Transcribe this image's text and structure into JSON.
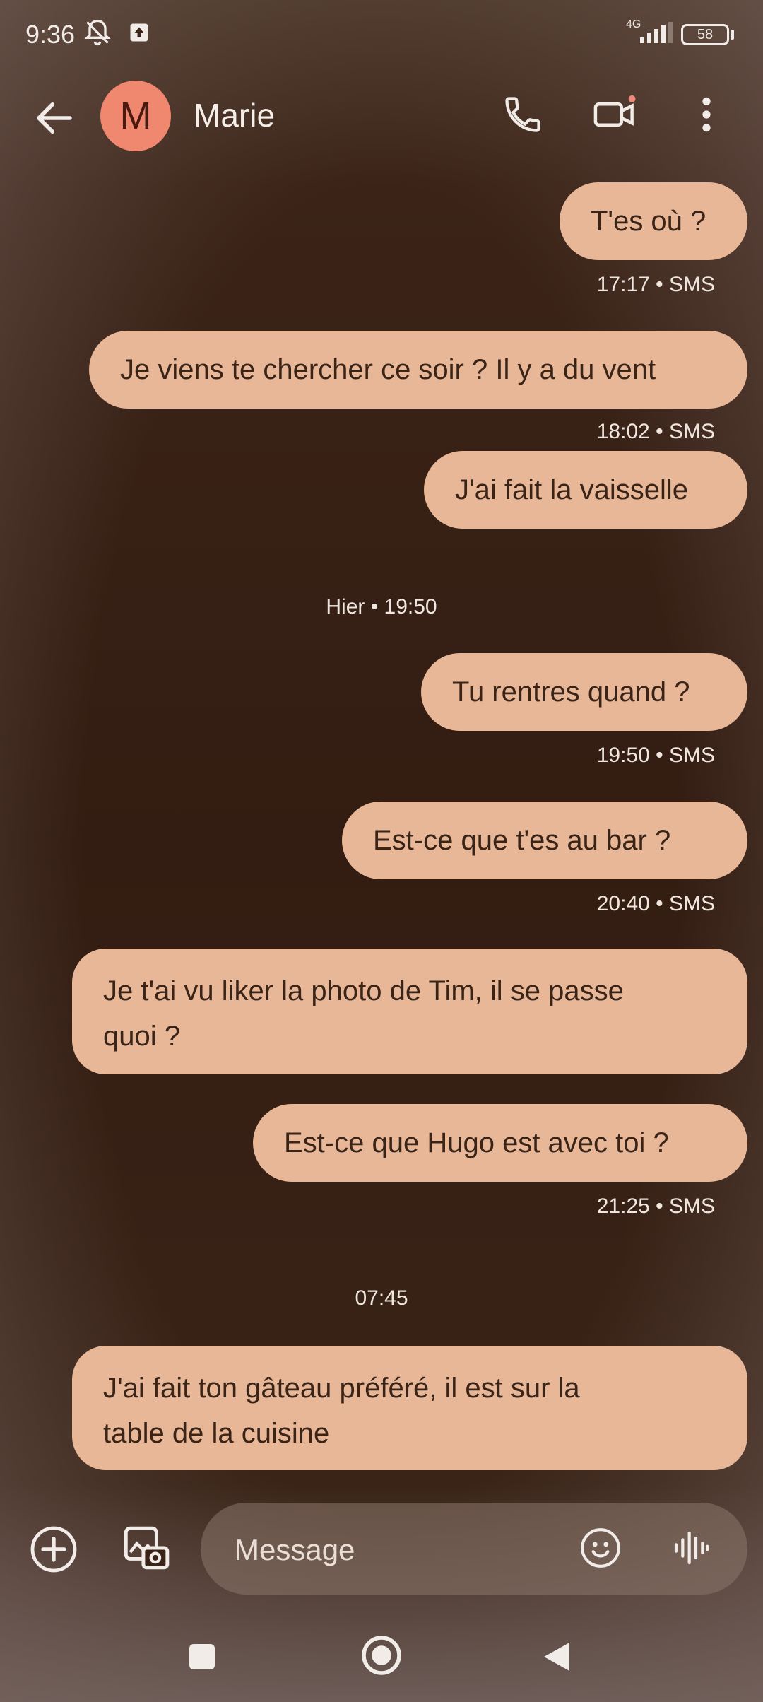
{
  "status_bar": {
    "time": "9:36",
    "network": "4G",
    "battery": "58"
  },
  "header": {
    "avatar_letter": "M",
    "contact_name": "Marie",
    "icons": [
      "back-arrow-icon",
      "phone-icon",
      "video-call-icon",
      "more-vert-icon"
    ]
  },
  "messages": [
    {
      "text": "T'es où ?",
      "meta": "17:17 • SMS"
    },
    {
      "text": "Je viens te chercher ce soir ? Il y a du vent",
      "meta": "18:02 • SMS"
    },
    {
      "text": "J'ai fait la vaisselle",
      "meta": ""
    },
    {
      "text": "Tu rentres quand ?",
      "meta": "19:50 • SMS"
    },
    {
      "text": "Est-ce que t'es au bar ?",
      "meta": "20:40 • SMS"
    },
    {
      "text_line1": "Je t'ai vu liker la photo de Tim, il se passe",
      "text_line2": "quoi ?",
      "meta": ""
    },
    {
      "text": "Est-ce que Hugo est avec toi ?",
      "meta": "21:25 • SMS"
    },
    {
      "text_line1": "J'ai fait ton gâteau préféré, il est sur la",
      "text_line2": "table de la cuisine",
      "meta": ""
    }
  ],
  "separators": {
    "yesterday": "Hier  • 19:50",
    "today": "07:45"
  },
  "composer": {
    "placeholder": "Message",
    "icons": [
      "add-circle-icon",
      "gallery-camera-icon",
      "emoji-icon",
      "voice-icon"
    ]
  },
  "colors": {
    "bubble": "#e7b797",
    "avatar": "#f0876f",
    "background": "#3a2418"
  }
}
